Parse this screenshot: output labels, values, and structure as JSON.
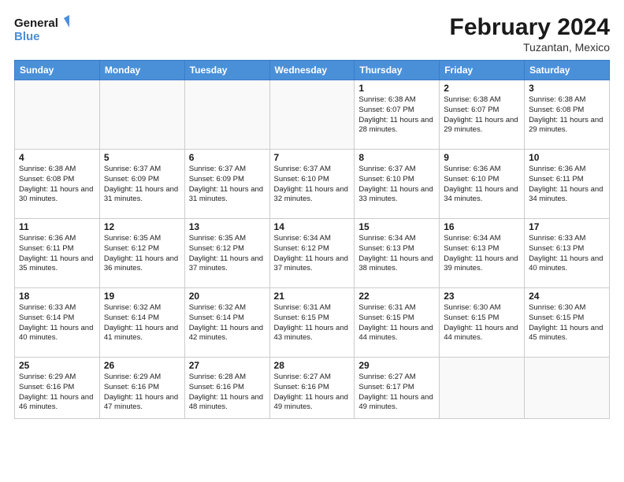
{
  "logo": {
    "line1": "General",
    "line2": "Blue"
  },
  "title": "February 2024",
  "subtitle": "Tuzantan, Mexico",
  "weekdays": [
    "Sunday",
    "Monday",
    "Tuesday",
    "Wednesday",
    "Thursday",
    "Friday",
    "Saturday"
  ],
  "weeks": [
    [
      {
        "day": "",
        "info": ""
      },
      {
        "day": "",
        "info": ""
      },
      {
        "day": "",
        "info": ""
      },
      {
        "day": "",
        "info": ""
      },
      {
        "day": "1",
        "info": "Sunrise: 6:38 AM\nSunset: 6:07 PM\nDaylight: 11 hours and 28 minutes."
      },
      {
        "day": "2",
        "info": "Sunrise: 6:38 AM\nSunset: 6:07 PM\nDaylight: 11 hours and 29 minutes."
      },
      {
        "day": "3",
        "info": "Sunrise: 6:38 AM\nSunset: 6:08 PM\nDaylight: 11 hours and 29 minutes."
      }
    ],
    [
      {
        "day": "4",
        "info": "Sunrise: 6:38 AM\nSunset: 6:08 PM\nDaylight: 11 hours and 30 minutes."
      },
      {
        "day": "5",
        "info": "Sunrise: 6:37 AM\nSunset: 6:09 PM\nDaylight: 11 hours and 31 minutes."
      },
      {
        "day": "6",
        "info": "Sunrise: 6:37 AM\nSunset: 6:09 PM\nDaylight: 11 hours and 31 minutes."
      },
      {
        "day": "7",
        "info": "Sunrise: 6:37 AM\nSunset: 6:10 PM\nDaylight: 11 hours and 32 minutes."
      },
      {
        "day": "8",
        "info": "Sunrise: 6:37 AM\nSunset: 6:10 PM\nDaylight: 11 hours and 33 minutes."
      },
      {
        "day": "9",
        "info": "Sunrise: 6:36 AM\nSunset: 6:10 PM\nDaylight: 11 hours and 34 minutes."
      },
      {
        "day": "10",
        "info": "Sunrise: 6:36 AM\nSunset: 6:11 PM\nDaylight: 11 hours and 34 minutes."
      }
    ],
    [
      {
        "day": "11",
        "info": "Sunrise: 6:36 AM\nSunset: 6:11 PM\nDaylight: 11 hours and 35 minutes."
      },
      {
        "day": "12",
        "info": "Sunrise: 6:35 AM\nSunset: 6:12 PM\nDaylight: 11 hours and 36 minutes."
      },
      {
        "day": "13",
        "info": "Sunrise: 6:35 AM\nSunset: 6:12 PM\nDaylight: 11 hours and 37 minutes."
      },
      {
        "day": "14",
        "info": "Sunrise: 6:34 AM\nSunset: 6:12 PM\nDaylight: 11 hours and 37 minutes."
      },
      {
        "day": "15",
        "info": "Sunrise: 6:34 AM\nSunset: 6:13 PM\nDaylight: 11 hours and 38 minutes."
      },
      {
        "day": "16",
        "info": "Sunrise: 6:34 AM\nSunset: 6:13 PM\nDaylight: 11 hours and 39 minutes."
      },
      {
        "day": "17",
        "info": "Sunrise: 6:33 AM\nSunset: 6:13 PM\nDaylight: 11 hours and 40 minutes."
      }
    ],
    [
      {
        "day": "18",
        "info": "Sunrise: 6:33 AM\nSunset: 6:14 PM\nDaylight: 11 hours and 40 minutes."
      },
      {
        "day": "19",
        "info": "Sunrise: 6:32 AM\nSunset: 6:14 PM\nDaylight: 11 hours and 41 minutes."
      },
      {
        "day": "20",
        "info": "Sunrise: 6:32 AM\nSunset: 6:14 PM\nDaylight: 11 hours and 42 minutes."
      },
      {
        "day": "21",
        "info": "Sunrise: 6:31 AM\nSunset: 6:15 PM\nDaylight: 11 hours and 43 minutes."
      },
      {
        "day": "22",
        "info": "Sunrise: 6:31 AM\nSunset: 6:15 PM\nDaylight: 11 hours and 44 minutes."
      },
      {
        "day": "23",
        "info": "Sunrise: 6:30 AM\nSunset: 6:15 PM\nDaylight: 11 hours and 44 minutes."
      },
      {
        "day": "24",
        "info": "Sunrise: 6:30 AM\nSunset: 6:15 PM\nDaylight: 11 hours and 45 minutes."
      }
    ],
    [
      {
        "day": "25",
        "info": "Sunrise: 6:29 AM\nSunset: 6:16 PM\nDaylight: 11 hours and 46 minutes."
      },
      {
        "day": "26",
        "info": "Sunrise: 6:29 AM\nSunset: 6:16 PM\nDaylight: 11 hours and 47 minutes."
      },
      {
        "day": "27",
        "info": "Sunrise: 6:28 AM\nSunset: 6:16 PM\nDaylight: 11 hours and 48 minutes."
      },
      {
        "day": "28",
        "info": "Sunrise: 6:27 AM\nSunset: 6:16 PM\nDaylight: 11 hours and 49 minutes."
      },
      {
        "day": "29",
        "info": "Sunrise: 6:27 AM\nSunset: 6:17 PM\nDaylight: 11 hours and 49 minutes."
      },
      {
        "day": "",
        "info": ""
      },
      {
        "day": "",
        "info": ""
      }
    ]
  ]
}
